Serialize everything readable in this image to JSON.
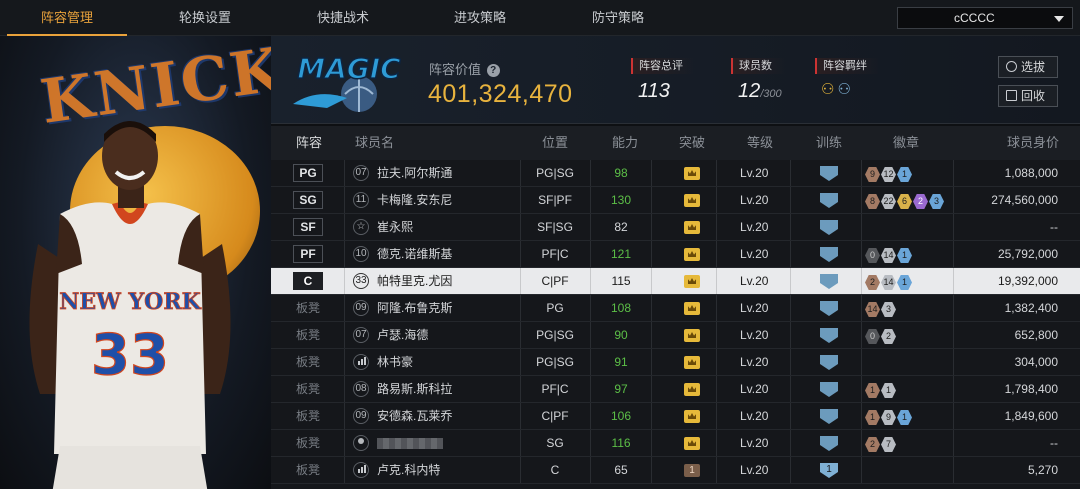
{
  "nav": {
    "tabs": [
      "阵容管理",
      "轮换设置",
      "快捷战术",
      "进攻策略",
      "防守策略"
    ],
    "active_index": 0,
    "team_select": "cCCCC"
  },
  "header": {
    "team_logo_text": "MAGIC",
    "value_label": "阵容价值",
    "value": "401,324,470",
    "rating_label": "阵容总评",
    "rating": "113",
    "players_label": "球员数",
    "players_count": "12",
    "players_max": "/300",
    "bond_label": "阵容羁绊",
    "btn_select": "选拔",
    "btn_recycle": "回收"
  },
  "table": {
    "headers": {
      "lineup": "阵容",
      "name": "球员名",
      "position": "位置",
      "ability": "能力",
      "breakthrough": "突破",
      "level": "等级",
      "training": "训练",
      "badges": "徽章",
      "value": "球员身价"
    },
    "rows": [
      {
        "slot": "PG",
        "num": "07",
        "name": "拉夫.阿尔斯通",
        "pos": "PG|SG",
        "ability": "98",
        "level": "Lv.20",
        "badges": [
          [
            "bronze",
            "9"
          ],
          [
            "silver",
            "12"
          ],
          [
            "blue",
            "1"
          ]
        ],
        "price": "1,088,000"
      },
      {
        "slot": "SG",
        "num": "11",
        "name": "卡梅隆.安东尼",
        "pos": "SF|PF",
        "ability": "130",
        "level": "Lv.20",
        "badges": [
          [
            "bronze",
            "8"
          ],
          [
            "silver",
            "22"
          ],
          [
            "gold",
            "6"
          ],
          [
            "purple",
            "2"
          ],
          [
            "blue",
            "3"
          ]
        ],
        "price": "274,560,000"
      },
      {
        "slot": "SF",
        "num": "☆",
        "name": "崔永熙",
        "pos": "SF|SG",
        "ability": "82",
        "level": "Lv.20",
        "badges": [],
        "price": "--"
      },
      {
        "slot": "PF",
        "num": "10",
        "name": "德克.诺维斯基",
        "pos": "PF|C",
        "ability": "121",
        "level": "Lv.20",
        "badges": [
          [
            "dark",
            "0"
          ],
          [
            "silver",
            "14"
          ],
          [
            "blue",
            "1"
          ]
        ],
        "price": "25,792,000"
      },
      {
        "slot": "C",
        "num": "33",
        "name": "帕特里克.尤因",
        "pos": "C|PF",
        "ability": "115",
        "level": "Lv.20",
        "badges": [
          [
            "bronze",
            "2"
          ],
          [
            "silver",
            "14"
          ],
          [
            "blue",
            "1"
          ]
        ],
        "price": "19,392,000"
      },
      {
        "slot": "板凳",
        "num": "09",
        "name": "阿隆.布鲁克斯",
        "pos": "PG",
        "ability": "108",
        "level": "Lv.20",
        "badges": [
          [
            "bronze",
            "14"
          ],
          [
            "silver",
            "3"
          ]
        ],
        "price": "1,382,400"
      },
      {
        "slot": "板凳",
        "num": "07",
        "name": "卢瑟.海德",
        "pos": "PG|SG",
        "ability": "90",
        "level": "Lv.20",
        "badges": [
          [
            "dark",
            "0"
          ],
          [
            "silver",
            "2"
          ]
        ],
        "price": "652,800"
      },
      {
        "slot": "板凳",
        "num": "bars",
        "name": "林书豪",
        "pos": "PG|SG",
        "ability": "91",
        "level": "Lv.20",
        "badges": [],
        "price": "304,000"
      },
      {
        "slot": "板凳",
        "num": "08",
        "name": "路易斯.斯科拉",
        "pos": "PF|C",
        "ability": "97",
        "level": "Lv.20",
        "badges": [
          [
            "bronze",
            "1"
          ],
          [
            "silver",
            "1"
          ]
        ],
        "price": "1,798,400"
      },
      {
        "slot": "板凳",
        "num": "09",
        "name": "安德森.瓦莱乔",
        "pos": "C|PF",
        "ability": "106",
        "level": "Lv.20",
        "badges": [
          [
            "bronze",
            "1"
          ],
          [
            "silver",
            "9"
          ],
          [
            "blue",
            "1"
          ]
        ],
        "price": "1,849,600"
      },
      {
        "slot": "板凳",
        "num": "user",
        "name": "",
        "pos": "SG",
        "ability": "116",
        "level": "Lv.20",
        "badges": [
          [
            "bronze",
            "2"
          ],
          [
            "silver",
            "7"
          ]
        ],
        "price": "--"
      },
      {
        "slot": "板凳",
        "num": "bars",
        "name": "卢克.科内特",
        "pos": "C",
        "ability": "65",
        "level": "Lv.20",
        "breakthrough": "1",
        "training": "1",
        "badges": [],
        "price": "5,270"
      }
    ]
  },
  "colors": {
    "accent": "#e9a23b",
    "ability_green": "#5cbf47",
    "value_gold": "#e8b33e"
  }
}
